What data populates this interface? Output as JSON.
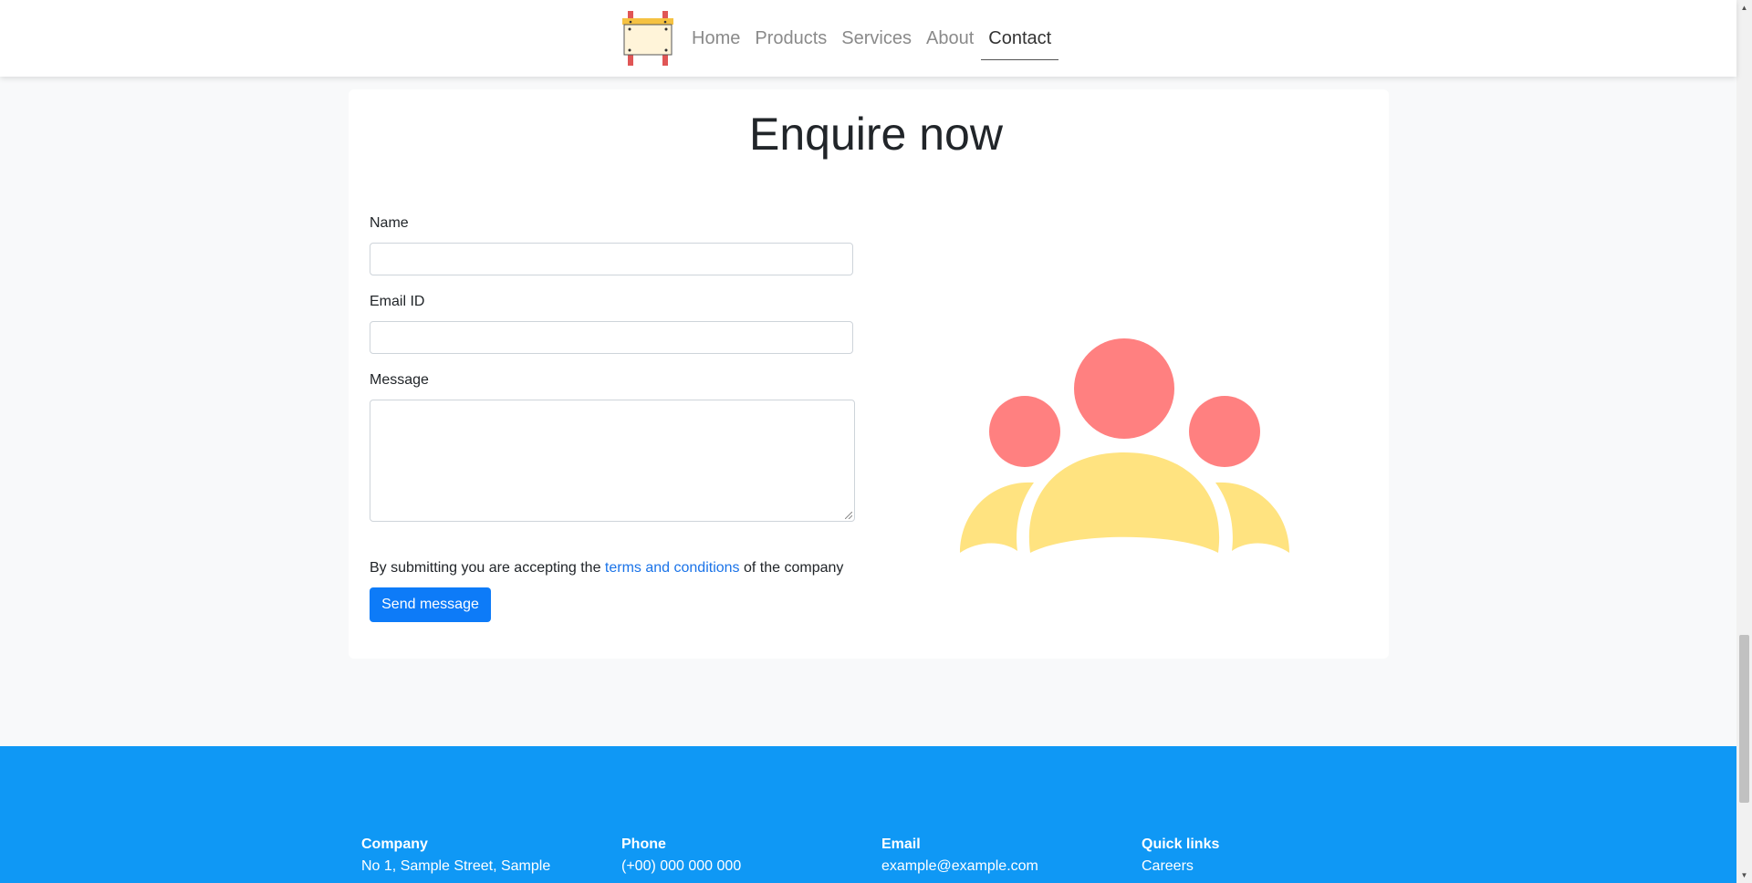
{
  "navbar": {
    "logo_icon": "signboard-logo",
    "links": [
      "Home",
      "Products",
      "Services",
      "About",
      "Contact"
    ],
    "active": "Contact"
  },
  "form": {
    "heading": "Enquire now",
    "name_label": "Name",
    "name_value": "",
    "email_label": "Email ID",
    "email_value": "",
    "message_label": "Message",
    "message_value": "",
    "consent_prefix": "By submitting you are accepting the ",
    "consent_link": "terms and conditions",
    "consent_suffix": " of the company",
    "submit_label": "Send message"
  },
  "illustration": {
    "icon": "group-people-illustration",
    "colors": {
      "heads": "#ff8080",
      "bodies": "#ffe380"
    }
  },
  "footer": {
    "company": {
      "title": "Company",
      "line1": "No 1, Sample Street, Sample"
    },
    "phone": {
      "title": "Phone",
      "line1": "(+00) 000 000 000"
    },
    "email": {
      "title": "Email",
      "line1": "example@example.com"
    },
    "quick_links": {
      "title": "Quick links",
      "line1": "Careers"
    }
  },
  "colors": {
    "primary_button": "#0d7bf8",
    "footer_background": "#0f98f5",
    "link": "#1a73e8"
  }
}
